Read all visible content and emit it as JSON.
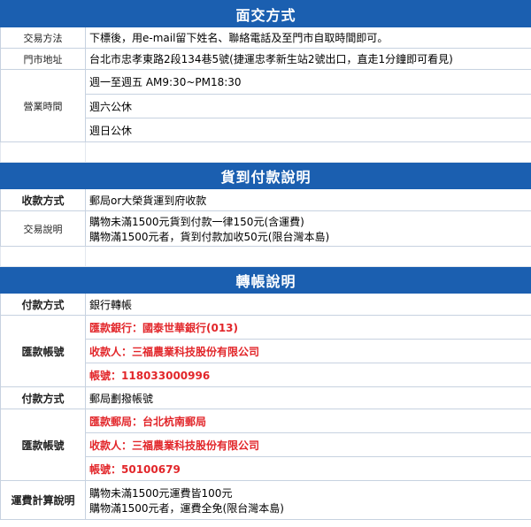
{
  "sections": {
    "face": {
      "title": "面交方式",
      "rows": {
        "method_label": "交易方法",
        "method_value": "下標後，用e-mail留下姓名、聯絡電話及至門市自取時間即可。",
        "address_label": "門市地址",
        "address_value": "台北市忠孝東路2段134巷5號(捷運忠孝新生站2號出口，直走1分鐘即可看見)",
        "hours_label": "營業時間",
        "hours_lines": [
          "週一至週五 AM9:30~PM18:30",
          "週六公休",
          "週日公休"
        ]
      }
    },
    "cod": {
      "title": "貨到付款說明",
      "collect_label": "收款方式",
      "collect_value": "郵局or大榮貨運到府收款",
      "explain_label": "交易說明",
      "explain_lines": [
        "購物未滿1500元貨到付款一律150元(含運費)",
        "購物滿1500元者，貨到付款加收50元(限台灣本島)"
      ]
    },
    "transfer": {
      "title": "轉帳說明",
      "pay1_label": "付款方式",
      "pay1_value": "銀行轉帳",
      "account1_label": "匯款帳號",
      "account1_lines": [
        "匯款銀行：國泰世華銀行(013)",
        "收款人：三福農業科技股份有限公司",
        "帳號：118033000996"
      ],
      "pay2_label": "付款方式",
      "pay2_value": "郵局劃撥帳號",
      "account2_label": "匯款帳號",
      "account2_lines": [
        "匯款郵局：台北杭南郵局",
        "收款人：三福農業科技股份有限公司",
        "帳號：50100679"
      ],
      "shipping_label": "運費計算說明",
      "shipping_lines": [
        "購物未滿1500元運費皆100元",
        "購物滿1500元者，運費全免(限台灣本島)"
      ]
    }
  },
  "colors": {
    "header_bg": "#1b5fb0",
    "highlight_text": "#e2262a",
    "border": "#c7d2e0"
  }
}
